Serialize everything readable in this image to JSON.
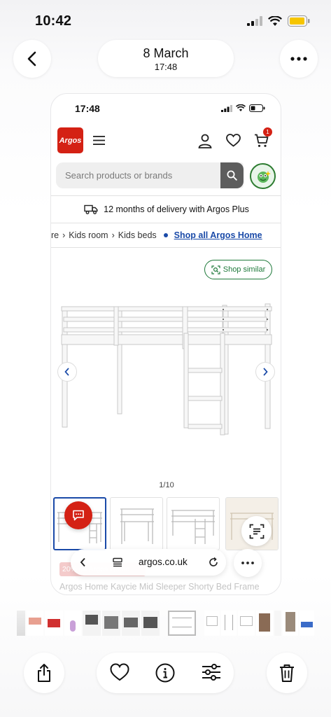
{
  "status_bar": {
    "time": "10:42"
  },
  "nav": {
    "back_icon": "chevron-left-icon",
    "date": "8 March",
    "time": "17:48",
    "more_icon": "ellipsis-icon"
  },
  "screenshot": {
    "status_time": "17:48",
    "header": {
      "logo_text": "Argos",
      "cart_count": "1",
      "icons": [
        "menu-icon",
        "account-icon",
        "heart-icon",
        "cart-icon"
      ]
    },
    "search": {
      "placeholder": "Search products or brands"
    },
    "delivery": {
      "text": "12 months of delivery with Argos Plus"
    },
    "breadcrumbs": {
      "items": [
        "re",
        "Kids room",
        "Kids beds"
      ],
      "shop_all": "Shop all Argos Home"
    },
    "shop_similar": "Shop similar",
    "image_counter": "1/10",
    "url": "argos.co.uk",
    "badge_text": "20% off Argos Home",
    "product_title": "Argos Home Kaycie Mid Sleeper Shorty Bed Frame",
    "colors": {
      "argos_red": "#d42114",
      "link_blue": "#1a4aa8",
      "similar_green": "#1f7a3b"
    }
  },
  "toolbar": {
    "icons": [
      "share-icon",
      "heart-icon",
      "info-icon",
      "adjust-icon",
      "trash-icon"
    ]
  }
}
